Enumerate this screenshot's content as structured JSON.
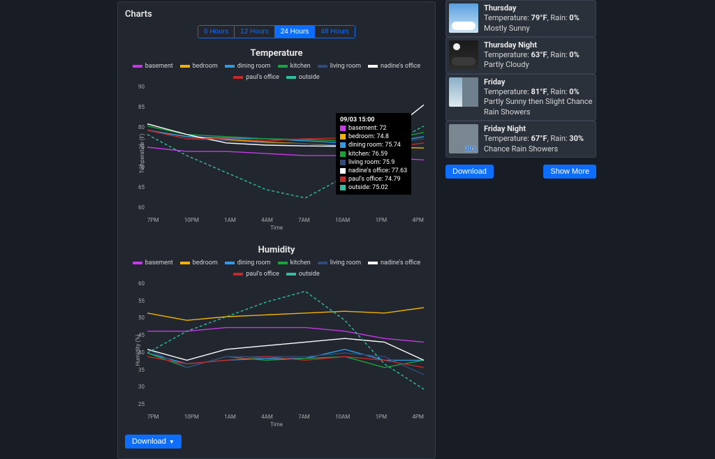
{
  "panel_title": "Charts",
  "ranges": [
    "6 Hours",
    "12 Hours",
    "24 Hours",
    "48 Hours"
  ],
  "active_range": 2,
  "download_label": "Download",
  "show_more_label": "Show More",
  "legend_series": [
    {
      "name": "basement",
      "color": "#c63ae6"
    },
    {
      "name": "bedroom",
      "color": "#f0b400"
    },
    {
      "name": "dining room",
      "color": "#2f9be8"
    },
    {
      "name": "kitchen",
      "color": "#1aa33a"
    },
    {
      "name": "living room",
      "color": "#324b7b"
    },
    {
      "name": "nadine's office",
      "color": "#ffffff"
    },
    {
      "name": "paul's office",
      "color": "#c62828"
    },
    {
      "name": "outside",
      "color": "#2fbfa0"
    }
  ],
  "tooltip": {
    "time": "09/03 15:00",
    "rows": [
      {
        "name": "basement",
        "value": "72",
        "color": "#c63ae6"
      },
      {
        "name": "bedroom",
        "value": "74.8",
        "color": "#f0b400"
      },
      {
        "name": "dining room",
        "value": "75.74",
        "color": "#2f9be8"
      },
      {
        "name": "kitchen",
        "value": "76.59",
        "color": "#1aa33a"
      },
      {
        "name": "living room",
        "value": "75.9",
        "color": "#324b7b"
      },
      {
        "name": "nadine's office",
        "value": "77.63",
        "color": "#ffffff"
      },
      {
        "name": "paul's office",
        "value": "74.79",
        "color": "#c62828"
      },
      {
        "name": "outside",
        "value": "75.02",
        "color": "#2fbfa0"
      }
    ]
  },
  "chart_data": [
    {
      "type": "line",
      "title": "Temperature",
      "xlabel": "Time",
      "ylabel": "Temperature (F)",
      "ylim": [
        60,
        90
      ],
      "x": [
        "7PM",
        "10PM",
        "1AM",
        "4AM",
        "7AM",
        "10AM",
        "1PM",
        "4PM"
      ],
      "series": [
        {
          "name": "basement",
          "color": "#c63ae6",
          "values": [
            75,
            74,
            74,
            73.5,
            73,
            73,
            72.5,
            72
          ]
        },
        {
          "name": "bedroom",
          "color": "#f0b400",
          "values": [
            79,
            77.5,
            76.8,
            76.2,
            75.8,
            75.3,
            75,
            74.8
          ]
        },
        {
          "name": "dining room",
          "color": "#2f9be8",
          "values": [
            79,
            77.5,
            77.2,
            77,
            76.5,
            76,
            75.9,
            77.5
          ]
        },
        {
          "name": "kitchen",
          "color": "#1aa33a",
          "values": [
            80,
            78,
            77.5,
            77,
            76.8,
            76.5,
            76.6,
            78.5
          ]
        },
        {
          "name": "living room",
          "color": "#324b7b",
          "values": [
            79,
            77,
            76.5,
            76,
            75.8,
            75.5,
            75.9,
            77
          ]
        },
        {
          "name": "nadine's office",
          "color": "#ffffff",
          "values": [
            80.5,
            78,
            76,
            75.5,
            75.3,
            75.2,
            77.6,
            85
          ]
        },
        {
          "name": "paul's office",
          "color": "#c62828",
          "values": [
            79,
            77,
            77,
            76.5,
            77,
            77.2,
            74.8,
            76
          ]
        },
        {
          "name": "outside",
          "color": "#2fbfa0",
          "values": [
            78,
            73,
            69,
            65,
            63,
            68,
            75,
            80
          ],
          "dashed": true
        }
      ]
    },
    {
      "type": "line",
      "title": "Humidity",
      "xlabel": "Time",
      "ylabel": "Humidity (%)",
      "ylim": [
        25,
        60
      ],
      "x": [
        "7PM",
        "10PM",
        "1AM",
        "4AM",
        "7AM",
        "10AM",
        "1PM",
        "4PM"
      ],
      "series": [
        {
          "name": "basement",
          "color": "#c63ae6",
          "values": [
            46,
            46,
            47,
            47,
            47,
            46,
            44,
            43
          ]
        },
        {
          "name": "bedroom",
          "color": "#f0b400",
          "values": [
            51,
            49,
            50,
            50.5,
            51,
            51.5,
            51,
            52.5
          ]
        },
        {
          "name": "dining room",
          "color": "#2f9be8",
          "values": [
            40,
            37,
            38,
            38.5,
            38.5,
            41,
            38,
            38
          ]
        },
        {
          "name": "kitchen",
          "color": "#1aa33a",
          "values": [
            40,
            36,
            39,
            38,
            38.5,
            39,
            36,
            38
          ]
        },
        {
          "name": "living room",
          "color": "#324b7b",
          "values": [
            41,
            36,
            39,
            39,
            39,
            40,
            39,
            34
          ]
        },
        {
          "name": "nadine's office",
          "color": "#ffffff",
          "values": [
            41,
            38,
            41,
            42,
            43,
            44,
            43,
            38
          ]
        },
        {
          "name": "paul's office",
          "color": "#c62828",
          "values": [
            39,
            37,
            38,
            39,
            38,
            39,
            38,
            36
          ]
        },
        {
          "name": "outside",
          "color": "#2fbfa0",
          "values": [
            40,
            46,
            50,
            54,
            57,
            49,
            37,
            30
          ],
          "dashed": true
        }
      ]
    }
  ],
  "forecast": [
    {
      "title": "Thursday",
      "thumb": "sunny",
      "temp": "79°F",
      "rain": "0%",
      "desc": "Mostly Sunny",
      "rain_badge": ""
    },
    {
      "title": "Thursday Night",
      "thumb": "night",
      "temp": "63°F",
      "rain": "0%",
      "desc": "Partly Cloudy",
      "rain_badge": ""
    },
    {
      "title": "Friday",
      "thumb": "rain",
      "temp": "81°F",
      "rain": "0%",
      "desc": "Partly Sunny then Slight Chance Rain Showers",
      "rain_badge": ""
    },
    {
      "title": "Friday Night",
      "thumb": "rain30",
      "temp": "67°F",
      "rain": "30%",
      "desc": "Chance Rain Showers",
      "rain_badge": "30%"
    }
  ],
  "labels": {
    "temp_prefix": "Temperature: ",
    "rain_prefix": ", Rain: "
  }
}
